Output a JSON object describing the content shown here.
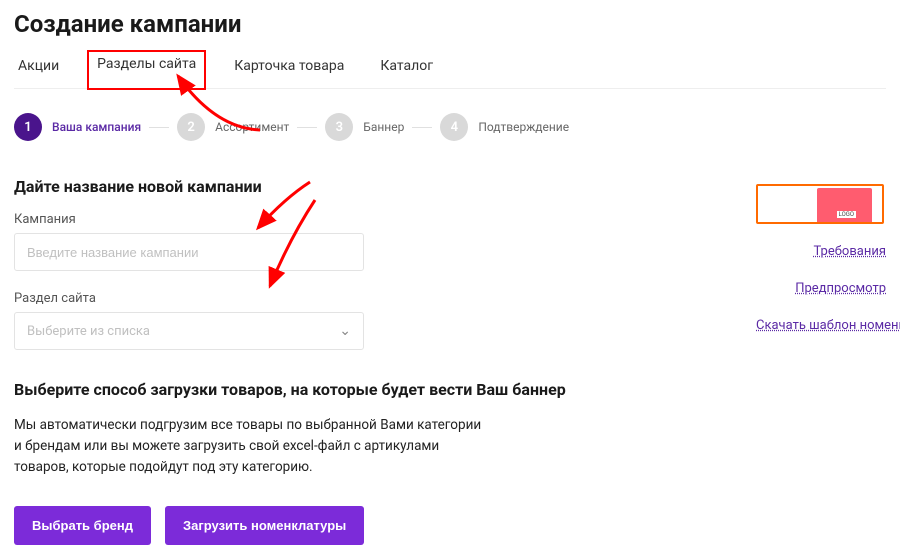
{
  "header": {
    "title": "Создание кампании"
  },
  "tabs": [
    {
      "label": "Акции",
      "highlighted": false
    },
    {
      "label": "Разделы сайта",
      "highlighted": true
    },
    {
      "label": "Карточка товара",
      "highlighted": false
    },
    {
      "label": "Каталог",
      "highlighted": false
    }
  ],
  "steps": [
    {
      "num": "1",
      "label": "Ваша кампания",
      "active": true
    },
    {
      "num": "2",
      "label": "Ассортимент",
      "active": false
    },
    {
      "num": "3",
      "label": "Баннер",
      "active": false
    },
    {
      "num": "4",
      "label": "Подтверждение",
      "active": false
    }
  ],
  "form": {
    "section_title": "Дайте название новой кампании",
    "campaign": {
      "label": "Кампания",
      "placeholder": "Введите название кампании",
      "value": ""
    },
    "section": {
      "label": "Раздел сайта",
      "placeholder": "Выберите из списка",
      "value": ""
    }
  },
  "load": {
    "title": "Выберите способ загрузки товаров, на которые будет вести Ваш баннер",
    "desc": "Мы автоматически подгрузим все товары по выбранной Вами категории и брендам или вы можете загрузить свой excel-файл с артикулами товаров, которые подойдут под эту категорию.",
    "btn_brand": "Выбрать бренд",
    "btn_upload": "Загрузить номенклатуры"
  },
  "sidebar": {
    "links": {
      "requirements": "Требования",
      "preview": "Предпросмотр",
      "download_template": "Скачать шаблон номенклатур"
    }
  },
  "colors": {
    "accent": "#7c2bd9",
    "step_active": "#4a148c",
    "highlight_border": "#ff0000",
    "preview_border": "#ff6a00"
  }
}
